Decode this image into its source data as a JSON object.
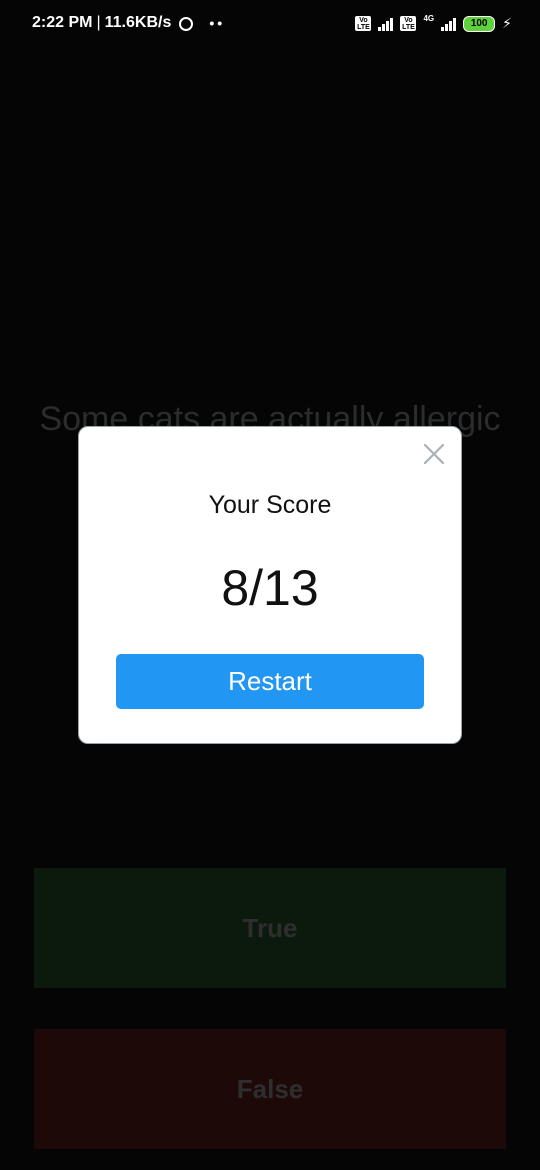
{
  "status_bar": {
    "time": "2:22 PM",
    "separator": "|",
    "speed": "11.6KB/s",
    "dots": "••",
    "volte_1": "Vo LTE",
    "volte_2": "Vo LTE",
    "network_type": "4G",
    "battery": "100",
    "charging_glyph": "⚡",
    "icons": [
      "alarm-icon",
      "volte-icon",
      "signal-icon",
      "volte-icon",
      "signal-icon",
      "battery-icon",
      "charging-icon"
    ]
  },
  "quiz": {
    "question": "Some cats are actually allergic",
    "true_label": "True",
    "false_label": "False"
  },
  "modal": {
    "title": "Your Score",
    "score": "8/13",
    "restart_label": "Restart",
    "close_icon": "close-icon"
  },
  "colors": {
    "background": "#050505",
    "accent": "#2196f3",
    "true_button": "#0c1a0d",
    "false_button": "#1e0909",
    "battery": "#5fd13a"
  }
}
